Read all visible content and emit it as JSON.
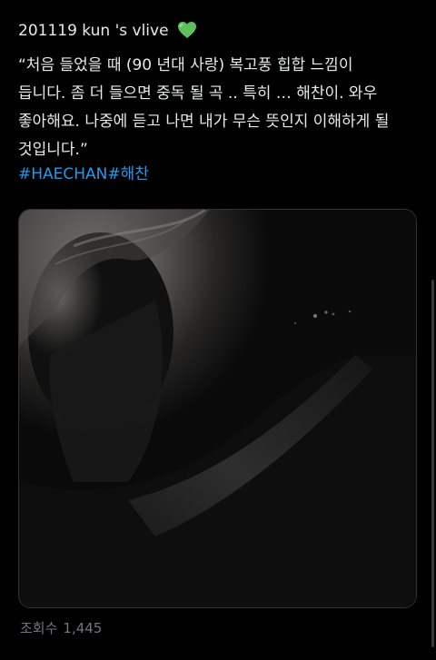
{
  "tweet": {
    "heading": "201119 kun 's vlive",
    "heading_emoji": "green-heart-icon",
    "quote_lines": [
      "“처음 들었을 때 (90 년대 사랑) 복고풍 힙합 느낌이",
      "듭니다. 좀 더 들으면 중독 될 곡 .. 특히 … 해찬이. 와우",
      "좋아해요. 나중에 듣고 나면 내가 무슨 뜻인지 이해하게 될",
      "것입니다.”"
    ],
    "hashtags": [
      "#HAECHAN",
      "#해찬"
    ],
    "views_label": "조회수",
    "views_count": "1,445"
  },
  "colors": {
    "background": "#000000",
    "text": "#e7e9ea",
    "link": "#1d9bf0",
    "muted": "#71767b",
    "heart": "#5dc05c"
  }
}
